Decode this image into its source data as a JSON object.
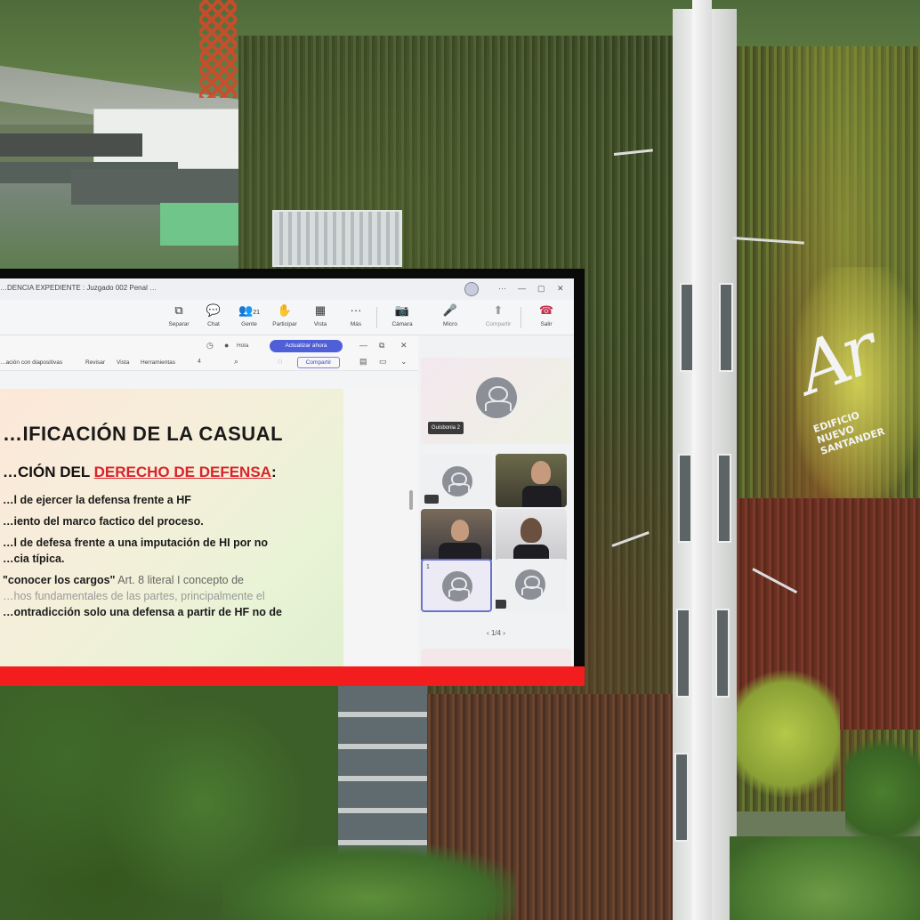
{
  "scene": {
    "logo": {
      "mark": "Ar",
      "subtitle_line1": "EDIFICIO",
      "subtitle_line2": "NUEVO SANTANDER"
    }
  },
  "window": {
    "title": "…DENCIA EXPEDIENTE : Juzgado 002 Penal …"
  },
  "teams_toolbar": {
    "items": [
      {
        "label": "Separar",
        "icon": "⧉"
      },
      {
        "label": "Chat",
        "icon": "💬"
      },
      {
        "label": "Gente",
        "icon": "👥",
        "badge": "21"
      },
      {
        "label": "Participar",
        "icon": "✋"
      },
      {
        "label": "Vista",
        "icon": "▦"
      },
      {
        "label": "Más",
        "icon": "···"
      },
      {
        "label": "Cámara",
        "icon": "📷"
      },
      {
        "label": "Micro",
        "icon": "🎤"
      },
      {
        "label": "Compartir",
        "icon": "⬆"
      },
      {
        "label": "Salir",
        "icon": "☎"
      }
    ]
  },
  "doc_toolbar": {
    "user": "Hola",
    "pill": "Actualizar ahora",
    "menu": [
      "…ación con diapositivas",
      "Revisar",
      "Vista",
      "Herramientas"
    ],
    "zoom": "4",
    "share_button": "Compartir"
  },
  "slide": {
    "title": "…IFICACIÓN DE LA CASUAL",
    "subtitle_prefix": "…CIÓN DEL ",
    "subtitle_highlight": "DERECHO DE DEFENSA",
    "subtitle_suffix": ":",
    "lines": [
      "…l de ejercer la defensa frente a HF",
      "…iento del marco factico del proceso.",
      "…l de defesa frente a una imputación de HI por no",
      "…cia típica."
    ],
    "quote_bold": "\"conocer los cargos\"",
    "quote_rest": " Art. 8 literal I  concepto de",
    "faded_line": "…hos fundamentales de las partes, principalmente el",
    "last_bold": "…ontradicción  solo una defensa a partir de HF no de"
  },
  "gallery": {
    "big_tile_name": "Guisbonia 2",
    "pager": "1/4",
    "self_badge": "1"
  }
}
